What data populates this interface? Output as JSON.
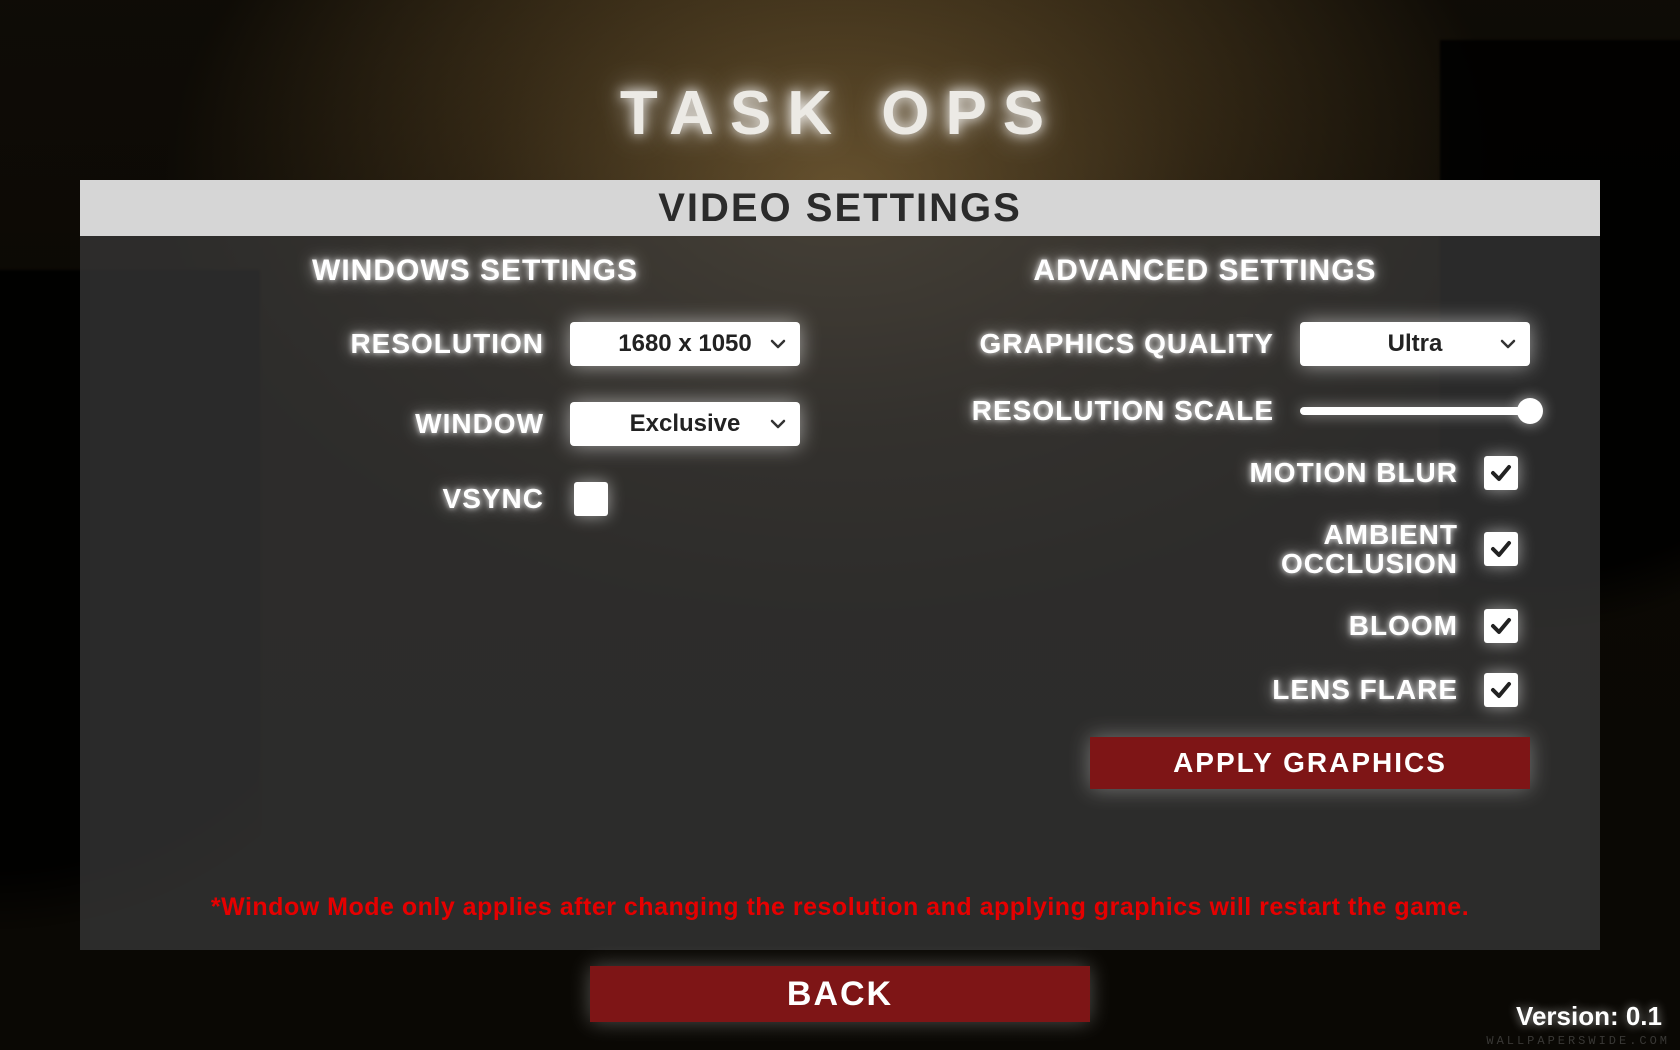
{
  "game_title": "TASK OPS",
  "panel_title": "VIDEO SETTINGS",
  "windows": {
    "heading": "WINDOWS SETTINGS",
    "resolution_label": "RESOLUTION",
    "resolution_value": "1680 x 1050",
    "window_label": "WINDOW",
    "window_value": "Exclusive",
    "vsync_label": "VSYNC",
    "vsync_checked": false
  },
  "advanced": {
    "heading": "ADVANCED SETTINGS",
    "quality_label": "GRAPHICS QUALITY",
    "quality_value": "Ultra",
    "res_scale_label": "RESOLUTION SCALE",
    "res_scale_percent": 100,
    "motion_blur_label": "MOTION BLUR",
    "motion_blur_checked": true,
    "ao_label": "AMBIENT OCCLUSION",
    "ao_checked": true,
    "bloom_label": "BLOOM",
    "bloom_checked": true,
    "lens_flare_label": "LENS FLARE",
    "lens_flare_checked": true,
    "apply_label": "APPLY GRAPHICS"
  },
  "note": "*Window Mode only applies after changing the resolution and applying graphics will restart the game.",
  "back_label": "BACK",
  "version_label": "Version: 0.1",
  "watermark": "WALLPAPERSWIDE.COM",
  "colors": {
    "accent": "#7e1516"
  }
}
